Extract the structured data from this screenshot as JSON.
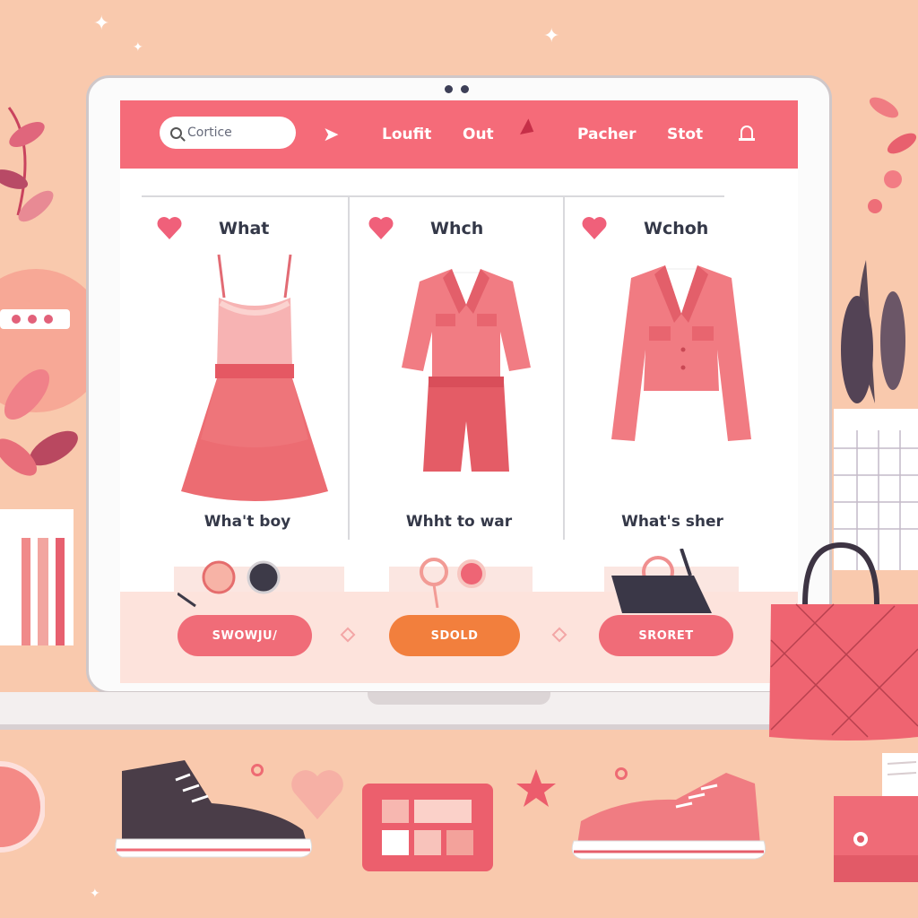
{
  "navbar": {
    "search_placeholder": "Cortice",
    "items": [
      "Loufit",
      "Out",
      "Pacher",
      "Stot"
    ]
  },
  "cards": [
    {
      "title": "What",
      "caption": "Wha't boy"
    },
    {
      "title": "Whch",
      "caption": "Whht to war"
    },
    {
      "title": "Wchoh",
      "caption": "What's sher"
    }
  ],
  "buttons": [
    "SWOWJU/",
    "SDOLD",
    "SRORET"
  ],
  "colors": {
    "background": "#f9c9ad",
    "navbar": "#f56b79",
    "accent_coral": "#f06c78",
    "accent_orange": "#f27f3d",
    "heart": "#f0607a"
  },
  "icons": [
    "search-icon",
    "arrow-icon",
    "cursor-icon",
    "bell-icon",
    "heart-icon"
  ]
}
